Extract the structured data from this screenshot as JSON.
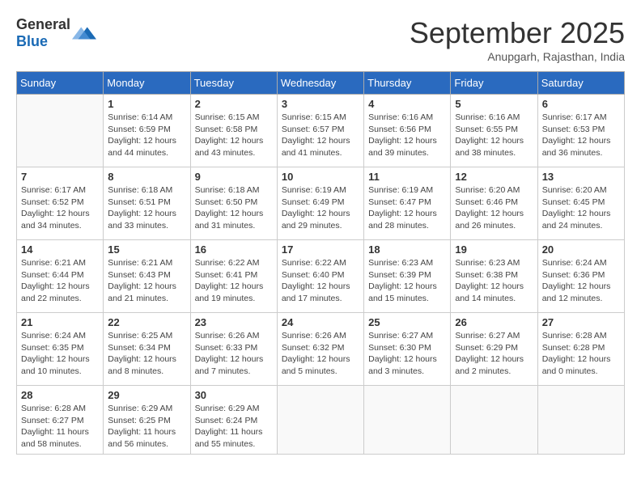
{
  "header": {
    "logo_general": "General",
    "logo_blue": "Blue",
    "month": "September 2025",
    "location": "Anupgarh, Rajasthan, India"
  },
  "days_of_week": [
    "Sunday",
    "Monday",
    "Tuesday",
    "Wednesday",
    "Thursday",
    "Friday",
    "Saturday"
  ],
  "weeks": [
    [
      {
        "day": "",
        "info": ""
      },
      {
        "day": "1",
        "info": "Sunrise: 6:14 AM\nSunset: 6:59 PM\nDaylight: 12 hours\nand 44 minutes."
      },
      {
        "day": "2",
        "info": "Sunrise: 6:15 AM\nSunset: 6:58 PM\nDaylight: 12 hours\nand 43 minutes."
      },
      {
        "day": "3",
        "info": "Sunrise: 6:15 AM\nSunset: 6:57 PM\nDaylight: 12 hours\nand 41 minutes."
      },
      {
        "day": "4",
        "info": "Sunrise: 6:16 AM\nSunset: 6:56 PM\nDaylight: 12 hours\nand 39 minutes."
      },
      {
        "day": "5",
        "info": "Sunrise: 6:16 AM\nSunset: 6:55 PM\nDaylight: 12 hours\nand 38 minutes."
      },
      {
        "day": "6",
        "info": "Sunrise: 6:17 AM\nSunset: 6:53 PM\nDaylight: 12 hours\nand 36 minutes."
      }
    ],
    [
      {
        "day": "7",
        "info": "Sunrise: 6:17 AM\nSunset: 6:52 PM\nDaylight: 12 hours\nand 34 minutes."
      },
      {
        "day": "8",
        "info": "Sunrise: 6:18 AM\nSunset: 6:51 PM\nDaylight: 12 hours\nand 33 minutes."
      },
      {
        "day": "9",
        "info": "Sunrise: 6:18 AM\nSunset: 6:50 PM\nDaylight: 12 hours\nand 31 minutes."
      },
      {
        "day": "10",
        "info": "Sunrise: 6:19 AM\nSunset: 6:49 PM\nDaylight: 12 hours\nand 29 minutes."
      },
      {
        "day": "11",
        "info": "Sunrise: 6:19 AM\nSunset: 6:47 PM\nDaylight: 12 hours\nand 28 minutes."
      },
      {
        "day": "12",
        "info": "Sunrise: 6:20 AM\nSunset: 6:46 PM\nDaylight: 12 hours\nand 26 minutes."
      },
      {
        "day": "13",
        "info": "Sunrise: 6:20 AM\nSunset: 6:45 PM\nDaylight: 12 hours\nand 24 minutes."
      }
    ],
    [
      {
        "day": "14",
        "info": "Sunrise: 6:21 AM\nSunset: 6:44 PM\nDaylight: 12 hours\nand 22 minutes."
      },
      {
        "day": "15",
        "info": "Sunrise: 6:21 AM\nSunset: 6:43 PM\nDaylight: 12 hours\nand 21 minutes."
      },
      {
        "day": "16",
        "info": "Sunrise: 6:22 AM\nSunset: 6:41 PM\nDaylight: 12 hours\nand 19 minutes."
      },
      {
        "day": "17",
        "info": "Sunrise: 6:22 AM\nSunset: 6:40 PM\nDaylight: 12 hours\nand 17 minutes."
      },
      {
        "day": "18",
        "info": "Sunrise: 6:23 AM\nSunset: 6:39 PM\nDaylight: 12 hours\nand 15 minutes."
      },
      {
        "day": "19",
        "info": "Sunrise: 6:23 AM\nSunset: 6:38 PM\nDaylight: 12 hours\nand 14 minutes."
      },
      {
        "day": "20",
        "info": "Sunrise: 6:24 AM\nSunset: 6:36 PM\nDaylight: 12 hours\nand 12 minutes."
      }
    ],
    [
      {
        "day": "21",
        "info": "Sunrise: 6:24 AM\nSunset: 6:35 PM\nDaylight: 12 hours\nand 10 minutes."
      },
      {
        "day": "22",
        "info": "Sunrise: 6:25 AM\nSunset: 6:34 PM\nDaylight: 12 hours\nand 8 minutes."
      },
      {
        "day": "23",
        "info": "Sunrise: 6:26 AM\nSunset: 6:33 PM\nDaylight: 12 hours\nand 7 minutes."
      },
      {
        "day": "24",
        "info": "Sunrise: 6:26 AM\nSunset: 6:32 PM\nDaylight: 12 hours\nand 5 minutes."
      },
      {
        "day": "25",
        "info": "Sunrise: 6:27 AM\nSunset: 6:30 PM\nDaylight: 12 hours\nand 3 minutes."
      },
      {
        "day": "26",
        "info": "Sunrise: 6:27 AM\nSunset: 6:29 PM\nDaylight: 12 hours\nand 2 minutes."
      },
      {
        "day": "27",
        "info": "Sunrise: 6:28 AM\nSunset: 6:28 PM\nDaylight: 12 hours\nand 0 minutes."
      }
    ],
    [
      {
        "day": "28",
        "info": "Sunrise: 6:28 AM\nSunset: 6:27 PM\nDaylight: 11 hours\nand 58 minutes."
      },
      {
        "day": "29",
        "info": "Sunrise: 6:29 AM\nSunset: 6:25 PM\nDaylight: 11 hours\nand 56 minutes."
      },
      {
        "day": "30",
        "info": "Sunrise: 6:29 AM\nSunset: 6:24 PM\nDaylight: 11 hours\nand 55 minutes."
      },
      {
        "day": "",
        "info": ""
      },
      {
        "day": "",
        "info": ""
      },
      {
        "day": "",
        "info": ""
      },
      {
        "day": "",
        "info": ""
      }
    ]
  ]
}
